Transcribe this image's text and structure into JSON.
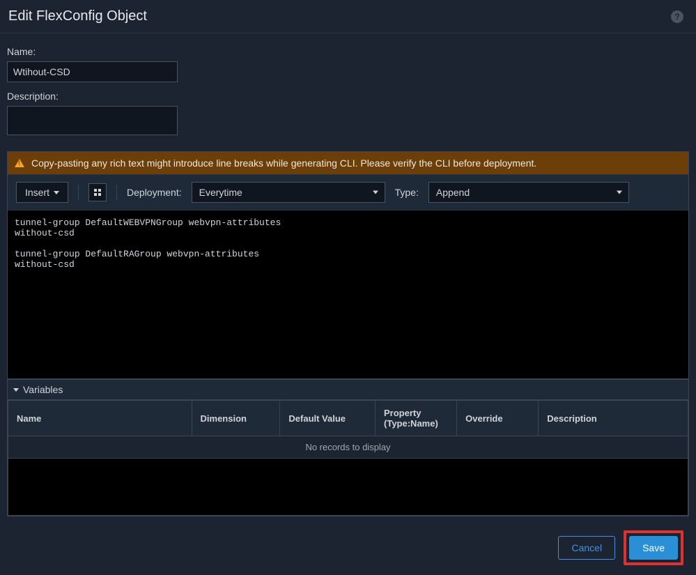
{
  "dialog": {
    "title": "Edit FlexConfig Object"
  },
  "form": {
    "name_label": "Name:",
    "name_value": "Wtihout-CSD",
    "description_label": "Description:",
    "description_value": ""
  },
  "warning": {
    "text": "Copy-pasting any rich text might introduce line breaks while generating CLI. Please verify the CLI before deployment."
  },
  "toolbar": {
    "insert_label": "Insert",
    "deployment_label": "Deployment:",
    "deployment_value": "Everytime",
    "type_label": "Type:",
    "type_value": "Append"
  },
  "cli_text": "tunnel-group DefaultWEBVPNGroup webvpn-attributes\nwithout-csd\n\ntunnel-group DefaultRAGroup webvpn-attributes\nwithout-csd",
  "variables": {
    "section_label": "Variables",
    "columns": {
      "name": "Name",
      "dimension": "Dimension",
      "default_value": "Default Value",
      "property": "Property\n(Type:Name)",
      "override": "Override",
      "description": "Description"
    },
    "empty_text": "No records to display"
  },
  "footer": {
    "cancel_label": "Cancel",
    "save_label": "Save"
  }
}
